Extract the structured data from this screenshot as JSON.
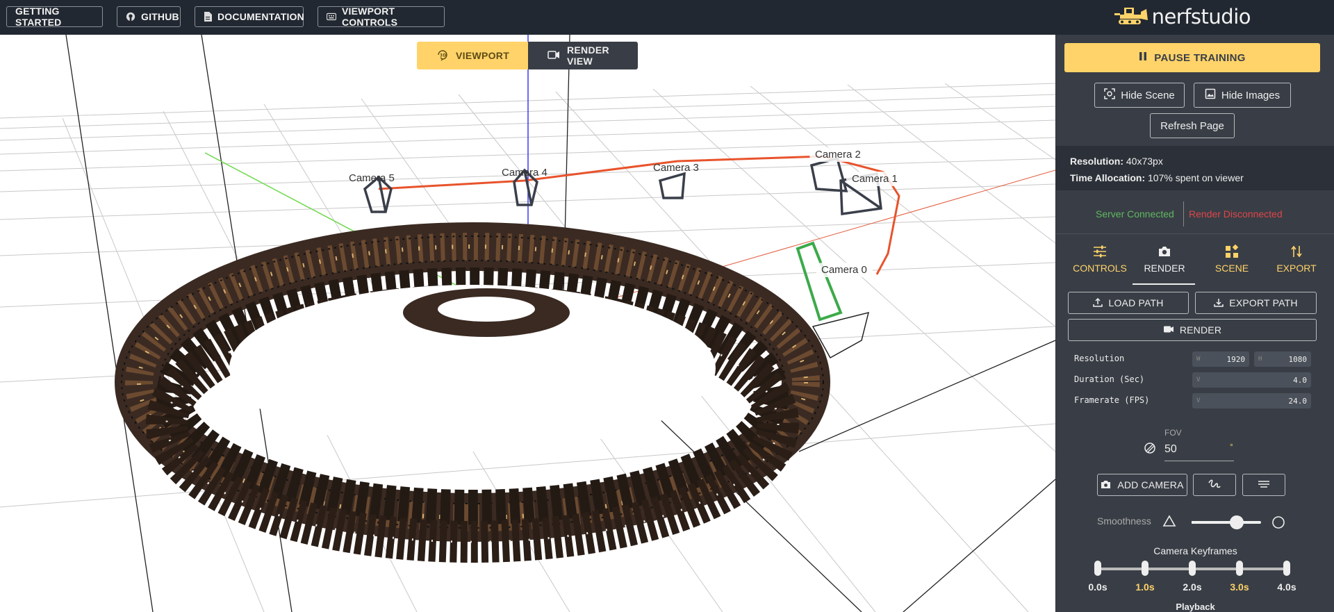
{
  "topbar": {
    "buttons": [
      {
        "label": "GETTING STARTED",
        "icon": "none"
      },
      {
        "label": "GITHUB",
        "icon": "github-icon"
      },
      {
        "label": "DOCUMENTATION",
        "icon": "document-icon"
      },
      {
        "label": "VIEWPORT CONTROLS",
        "icon": "keyboard-icon"
      }
    ],
    "logo_text": "nerfstudio"
  },
  "view_toggle": {
    "viewport_label": "VIEWPORT",
    "render_view_label": "RENDER VIEW",
    "active": "viewport"
  },
  "scene": {
    "cameras": [
      "Camera 5",
      "Camera 4",
      "Camera 3",
      "Camera 2",
      "Camera 1",
      "Camera 0"
    ]
  },
  "sidebar": {
    "pause_label": "PAUSE TRAINING",
    "hide_scene_label": "Hide Scene",
    "hide_images_label": "Hide Images",
    "refresh_label": "Refresh Page",
    "resolution_label": "Resolution:",
    "resolution_value": "40x73px",
    "time_alloc_label": "Time Allocation:",
    "time_alloc_value": "107% spent on viewer",
    "server_status": "Server Connected",
    "render_status": "Render Disconnected",
    "tabs": [
      "CONTROLS",
      "RENDER",
      "SCENE",
      "EXPORT"
    ],
    "active_tab": "RENDER",
    "load_path_label": "LOAD PATH",
    "export_path_label": "EXPORT PATH",
    "render_label": "RENDER",
    "fields": {
      "resolution_label": "Resolution",
      "res_w_key": "W",
      "res_w": "1920",
      "res_h_key": "H",
      "res_h": "1080",
      "duration_label": "Duration (Sec)",
      "duration_key": "V",
      "duration": "4.0",
      "framerate_label": "Framerate (FPS)",
      "framerate_key": "V",
      "framerate": "24.0"
    },
    "fov_label": "FOV",
    "fov_value": "50",
    "fov_unit": "°",
    "add_camera_label": "ADD CAMERA",
    "smoothness_label": "Smoothness",
    "smoothness_level": 0.65,
    "keyframes_title": "Camera Keyframes",
    "keyframe_times": [
      "0.0s",
      "1.0s",
      "2.0s",
      "3.0s",
      "4.0s"
    ],
    "playback_label": "Playback",
    "colors": {
      "accent": "#ffd369",
      "panel": "#393e46",
      "connected": "#5fb85f",
      "disconnected": "#e0454a"
    }
  }
}
